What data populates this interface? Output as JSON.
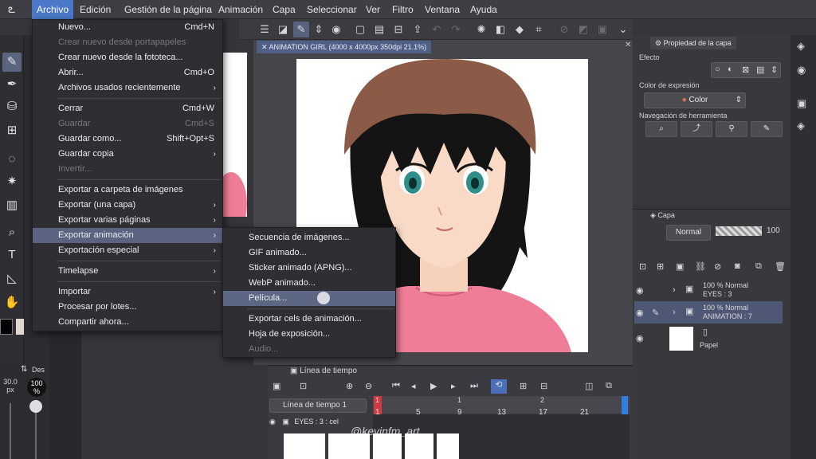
{
  "menubar": {
    "items": [
      "Archivo",
      "Edición",
      "Gestión de la página",
      "Animación",
      "Capa",
      "Seleccionar",
      "Ver",
      "Filtro",
      "Ventana",
      "Ayuda"
    ],
    "active": "Archivo"
  },
  "archivo_menu": {
    "items": [
      {
        "label": "Nuevo...",
        "shortcut": "Cmd+N"
      },
      {
        "label": "Crear nuevo desde portapapeles",
        "disabled": true
      },
      {
        "label": "Crear nuevo desde la fototeca..."
      },
      {
        "label": "Abrir...",
        "shortcut": "Cmd+O"
      },
      {
        "label": "Archivos usados recientemente",
        "submenu": true
      },
      {
        "label": "Cerrar",
        "shortcut": "Cmd+W"
      },
      {
        "label": "Guardar",
        "shortcut": "Cmd+S",
        "disabled": true
      },
      {
        "label": "Guardar como...",
        "shortcut": "Shift+Opt+S"
      },
      {
        "label": "Guardar copia",
        "submenu": true
      },
      {
        "label": "Invertir...",
        "disabled": true
      },
      {
        "label": "Exportar a carpeta de imágenes"
      },
      {
        "label": "Exportar (una capa)",
        "submenu": true
      },
      {
        "label": "Exportar varias páginas",
        "submenu": true
      },
      {
        "label": "Exportar animación",
        "submenu": true,
        "highlighted": true
      },
      {
        "label": "Exportación especial",
        "submenu": true
      },
      {
        "label": "Timelapse",
        "submenu": true
      },
      {
        "label": "Importar",
        "submenu": true
      },
      {
        "label": "Procesar por lotes..."
      },
      {
        "label": "Compartir ahora..."
      }
    ]
  },
  "export_animation_submenu": {
    "items": [
      {
        "label": "Secuencia de imágenes..."
      },
      {
        "label": "GIF animado..."
      },
      {
        "label": "Sticker animado (APNG)..."
      },
      {
        "label": "WebP animado..."
      },
      {
        "label": "Película...",
        "highlighted": true
      },
      {
        "label": "Exportar cels de animación..."
      },
      {
        "label": "Hoja de exposición..."
      },
      {
        "label": "Audio...",
        "disabled": true
      }
    ]
  },
  "document": {
    "tab_title": "ANIMATION GIRL (4000 x 4000px 350dpi 21.1%)"
  },
  "timeline": {
    "panel_title": "Línea de tiempo",
    "select_value": "Línea de tiempo 1",
    "ticks": [
      "1",
      "5",
      "9",
      "13",
      "17",
      "21"
    ],
    "ruler_top": [
      "1",
      "1",
      "2"
    ],
    "layer_label": "EYES : 3 : cel"
  },
  "layer_property": {
    "title": "Propiedad de la capa",
    "effect_label": "Efecto",
    "expression_color_label": "Color de expresión",
    "expression_color_value": "Color",
    "tool_nav_label": "Navegación de herramienta"
  },
  "layers_panel": {
    "title": "Capa",
    "blend_mode": "Normal",
    "opacity": "100",
    "layers": [
      {
        "line1": "100 % Normal",
        "line2": "EYES : 3"
      },
      {
        "line1": "100 % Normal",
        "line2": "ANIMATION : 7"
      },
      {
        "line1": "",
        "line2": "Papel"
      }
    ]
  },
  "brush": {
    "size": "30.0",
    "unit": "px",
    "opacity": "100",
    "opacity_unit": "%",
    "tab": "Des"
  },
  "watermark": "@kevinfm_art",
  "colors": {
    "accent": "#4b78c8",
    "highlight": "#5a6481",
    "menu_bg": "#2e2e33",
    "shirt": "#f07d98",
    "hair": "#141414"
  }
}
